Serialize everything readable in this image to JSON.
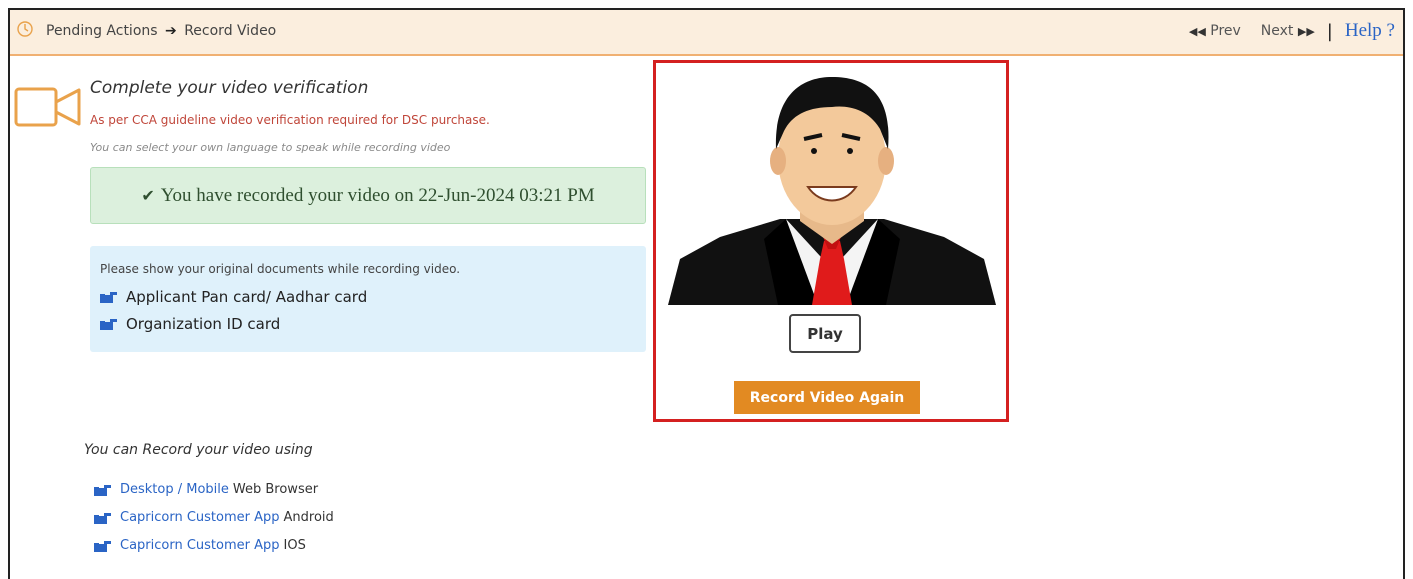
{
  "header": {
    "breadcrumb_root": "Pending Actions",
    "breadcrumb_current": "Record Video",
    "prev_label": "Prev",
    "next_label": "Next",
    "help_label": "Help ?"
  },
  "verification": {
    "title": "Complete your video verification",
    "cca_note": "As per CCA guideline video verification required for DSC purchase.",
    "language_note": "You can select your own language to speak while recording video",
    "success_message": "You have recorded your video on 22-Jun-2024 03:21 PM"
  },
  "documents": {
    "intro": "Please show your original documents while recording video.",
    "items": [
      "Applicant Pan card/ Aadhar card",
      "Organization ID card"
    ]
  },
  "video": {
    "play_label": "Play",
    "record_again_label": "Record Video Again"
  },
  "record_options": {
    "title": "You can Record your video using",
    "options": [
      {
        "link": "Desktop / Mobile",
        "suffix": "Web Browser"
      },
      {
        "link": "Capricorn Customer App",
        "suffix": "Android"
      },
      {
        "link": "Capricorn Customer App",
        "suffix": "IOS"
      }
    ]
  },
  "colors": {
    "accent_orange": "#e28a22",
    "highlight_red": "#d42020",
    "link_blue": "#2a64c5",
    "success_bg": "#dcf0dd",
    "info_bg": "#dff1fb"
  },
  "icons": {
    "header": "clock-icon",
    "title": "video-camera-icon",
    "success": "check-circle-icon",
    "list": "pointing-hand-icon"
  }
}
